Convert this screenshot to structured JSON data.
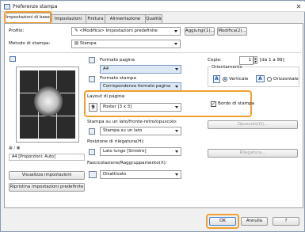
{
  "window": {
    "title": "Preferenze stampa"
  },
  "tabs": [
    "Impostazioni di base",
    "Impostazioni pagina",
    "Finitura",
    "Alimentazione carta",
    "Qualità"
  ],
  "profile": {
    "label": "Profilo:",
    "value": "<Modifica> Impostazioni predefinite",
    "add_button": "Aggiungi(1)...",
    "edit_button": "Modifica(2)..."
  },
  "output_method": {
    "label": "Metodo di stampa:",
    "value": "Stampa"
  },
  "preview": {
    "caption": "A4 [Proporzioni: Auto]",
    "controls": "▦ / ▣"
  },
  "left_buttons": {
    "view_settings": "Visualizza impostazioni",
    "restore_defaults": "Ripristina impostazioni predefinite"
  },
  "page_size": {
    "label": "Formato pagina",
    "value": "A4"
  },
  "output_size": {
    "label": "Formato stampa",
    "value": "Corrispondenza formato pagina"
  },
  "copies": {
    "label": "Copie:",
    "value": "1",
    "range": "[da 1 a 99]"
  },
  "orientation": {
    "label": "Orientamento",
    "portrait": "Verticale",
    "landscape": "Orizzontale"
  },
  "page_layout": {
    "label": "Layout di pagina:",
    "value": "Poster [3 x 3]",
    "icon_text": "9"
  },
  "page_border": {
    "label": "Bordo di stampa",
    "checked": true
  },
  "duplex": {
    "label": "Stampa su un lato/fronte-retro/opuscolo:",
    "value": "Stampa su un lato",
    "button": "Opuscolo(G)..."
  },
  "binding": {
    "label": "Posizione di rilegatura(H):",
    "value": "Lato lungo [Sinistro]",
    "button": "Rilegatura..."
  },
  "collate": {
    "label": "Fascicolazione/Raggruppamento(X):",
    "value": "Disattivato"
  },
  "footer": {
    "ok": "OK",
    "cancel": "Annulla",
    "help": "?"
  }
}
